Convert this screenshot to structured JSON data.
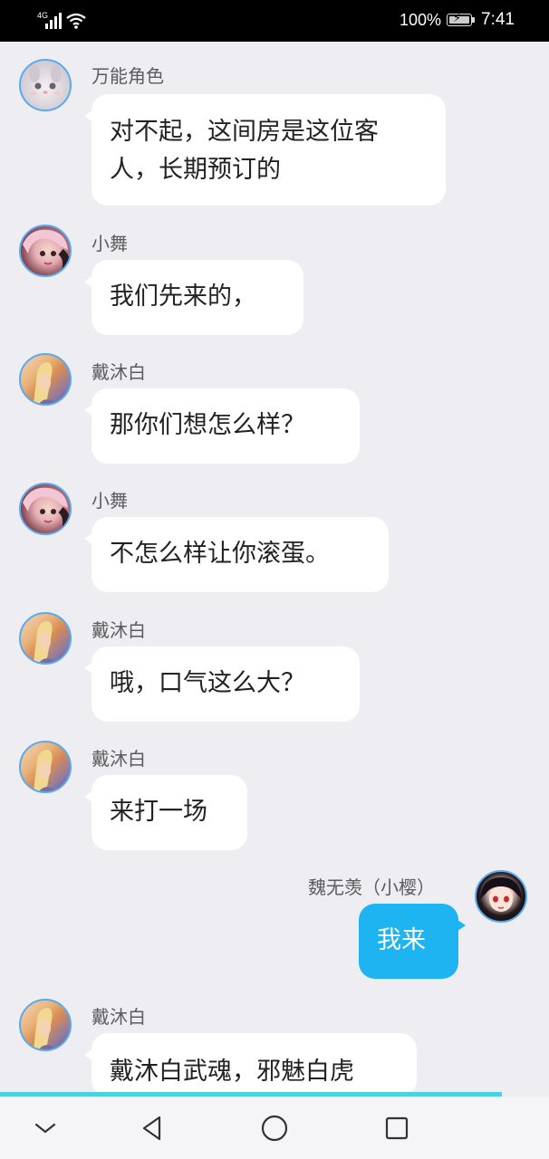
{
  "status_bar": {
    "network": "4G",
    "battery_percent": "100%",
    "time": "7:41"
  },
  "messages": [
    {
      "sender": "万能角色",
      "text_lines": [
        "对不起，这间房是这位客",
        "人，长期预订的"
      ],
      "side": "left"
    },
    {
      "sender": "小舞",
      "text_lines": [
        "我们先来的，"
      ],
      "side": "left"
    },
    {
      "sender": "戴沐白",
      "text_lines": [
        "那你们想怎么样？"
      ],
      "side": "left"
    },
    {
      "sender": "小舞",
      "text_lines": [
        "不怎么样让你滚蛋。"
      ],
      "side": "left"
    },
    {
      "sender": "戴沐白",
      "text_lines": [
        "哦，口气这么大？"
      ],
      "side": "left"
    },
    {
      "sender": "戴沐白",
      "text_lines": [
        "来打一场"
      ],
      "side": "left"
    },
    {
      "sender": "魏无羡（小樱）",
      "text_lines": [
        "我来"
      ],
      "side": "right"
    },
    {
      "sender": "戴沐白",
      "text_lines": [
        "戴沐白武魂，邪魅白虎"
      ],
      "side": "left"
    }
  ],
  "colors": {
    "background": "#ededf2",
    "my_bubble": "#1eb4f2",
    "avatar_border": "#5aaaf0",
    "progress_line": "#4bd1e4"
  },
  "nav_bar": {
    "icons": [
      "chevron-down-icon",
      "back-icon",
      "home-icon",
      "recents-icon"
    ]
  }
}
